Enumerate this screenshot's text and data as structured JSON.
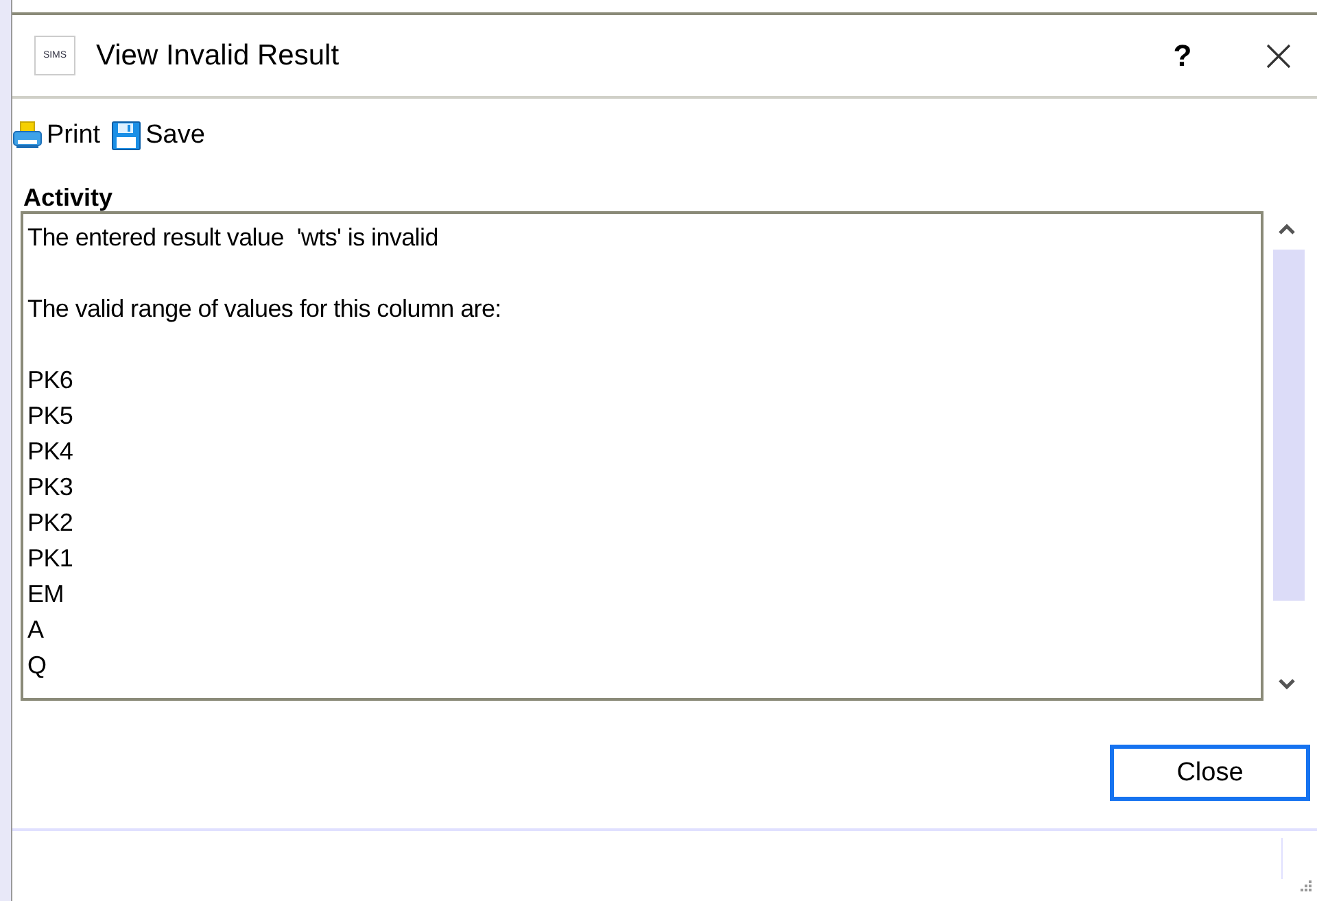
{
  "window": {
    "title": "View Invalid Result",
    "app_badge": "SIMS",
    "help_button": "?"
  },
  "toolbar": [
    {
      "kind": "print",
      "label": "Print"
    },
    {
      "kind": "save",
      "label": "Save"
    }
  ],
  "activity": {
    "label": "Activity",
    "paragraphs": [
      "The entered result value  'wts' is invalid",
      "The valid range of values for this column are:"
    ],
    "values": [
      "PK6",
      "PK5",
      "PK4",
      "PK3",
      "PK2",
      "PK1",
      "EM",
      "A",
      "Q"
    ]
  },
  "buttons": [
    {
      "label": "Close",
      "focused": true
    }
  ]
}
